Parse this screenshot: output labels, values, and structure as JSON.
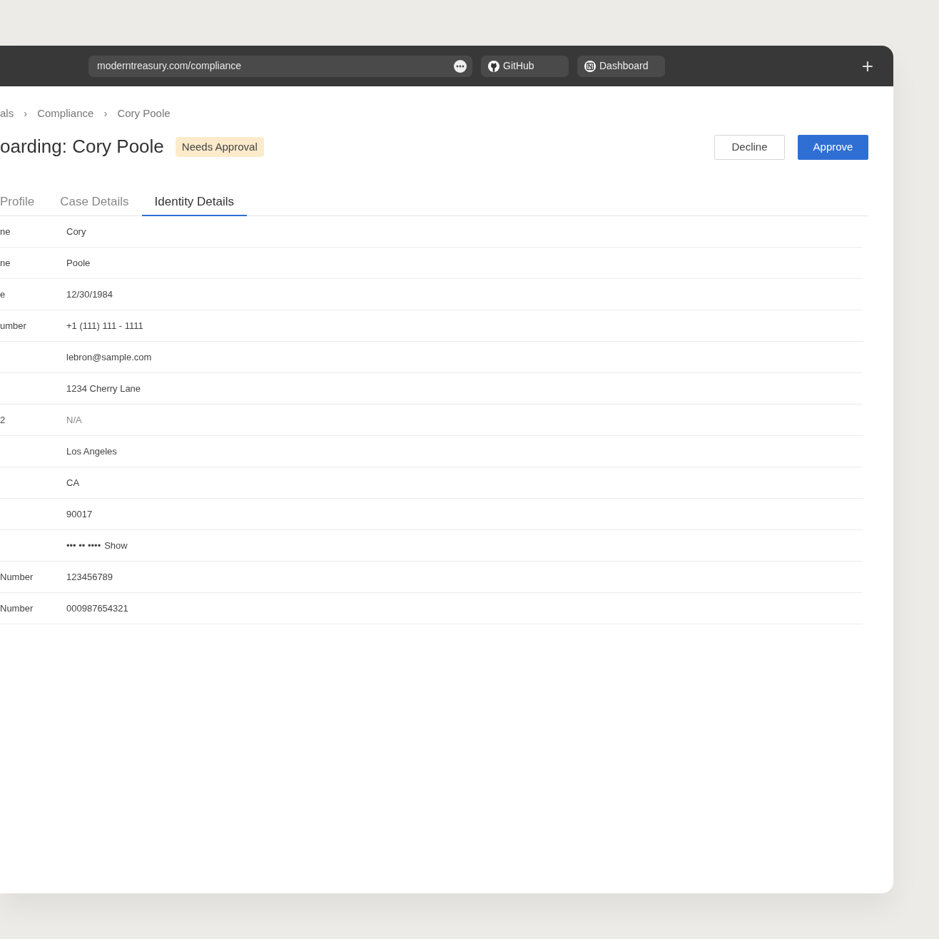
{
  "browser": {
    "url": "moderntreasury.com/compliance",
    "bookmarks": [
      {
        "label": "GitHub",
        "kind": "github"
      },
      {
        "label": "Dashboard",
        "kind": "notion"
      }
    ],
    "new_tab": "+"
  },
  "breadcrumb": [
    "als",
    "Compliance",
    "Cory Poole"
  ],
  "breadcrumb_separator": "›",
  "title": "oarding: Cory Poole",
  "status_badge": "Needs Approval",
  "buttons": [
    {
      "label": "Decline",
      "kind": "secondary"
    },
    {
      "label": "Approve",
      "kind": "primary"
    }
  ],
  "tabs": [
    {
      "label": "Profile",
      "selected": false
    },
    {
      "label": "Case Details",
      "selected": false
    },
    {
      "label": "Identity Details",
      "selected": true
    }
  ],
  "rows": [
    {
      "label": "ne",
      "value": "Cory",
      "muted": false
    },
    {
      "label": "ne",
      "value": "Poole",
      "muted": false
    },
    {
      "label": "e",
      "value": "12/30/1984",
      "muted": false
    },
    {
      "label": "umber",
      "value": "+1 (111) 111 - 1111",
      "muted": false
    },
    {
      "value": "lebron@sample.com",
      "muted": false
    },
    {
      "value": "1234 Cherry Lane",
      "muted": false
    },
    {
      "label": "2",
      "value": "N/A",
      "muted": true
    },
    {
      "value": "Los Angeles",
      "muted": false
    },
    {
      "value": "CA",
      "muted": false
    },
    {
      "value": "90017",
      "muted": false
    },
    {
      "value": "••• •• ••••",
      "action": "Show",
      "muted": false
    },
    {
      "label": "Number",
      "value": "123456789",
      "muted": false
    },
    {
      "label": "Number",
      "value": "000987654321",
      "muted": false
    }
  ]
}
